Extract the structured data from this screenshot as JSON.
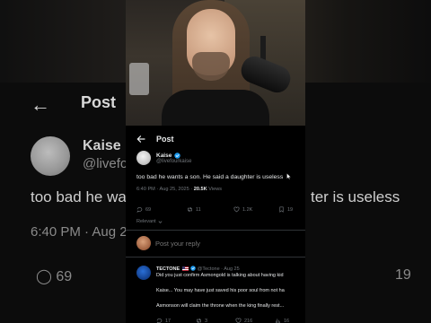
{
  "background": {
    "post_title": "Post",
    "author_name": "Kaise",
    "author_handle": "@livefor",
    "text_left": "too bad he wa",
    "text_right": "ter is useless",
    "time": "6:40 PM · Aug 2",
    "reply_count": "69",
    "right_count": "19"
  },
  "post": {
    "title": "Post",
    "back_icon": "arrow-left-icon"
  },
  "tweet": {
    "author_name": "Kaise",
    "author_handle": "@livefourkaise",
    "text": "too bad he wants a son. He said a daughter is useless",
    "time": "6:40 PM · Aug 25, 2025 · ",
    "views": "20.5K",
    "views_label": " Views",
    "replies": "69",
    "reposts": "11",
    "likes": "1.2K",
    "bookmarks": "19",
    "sort_label": "Relevant"
  },
  "compose": {
    "placeholder": "Post your reply"
  },
  "reply": {
    "name": "TECTONE",
    "handle_meta": "@Tectone · Aug 25",
    "line1": "Did you just confirm Asmongold is talking about having kid",
    "line2": "Kaise... You may have just saved his poor soul from not ha",
    "line3": "Asmonson will claim the throne when the king finally rest...",
    "replies": "17",
    "reposts": "3",
    "likes": "216",
    "bookmarks": "16"
  },
  "colors": {
    "background": "#000000",
    "text_primary": "#e7e9ea",
    "text_secondary": "#71767b",
    "verified": "#1d9bf0",
    "divider": "#2f3336"
  }
}
